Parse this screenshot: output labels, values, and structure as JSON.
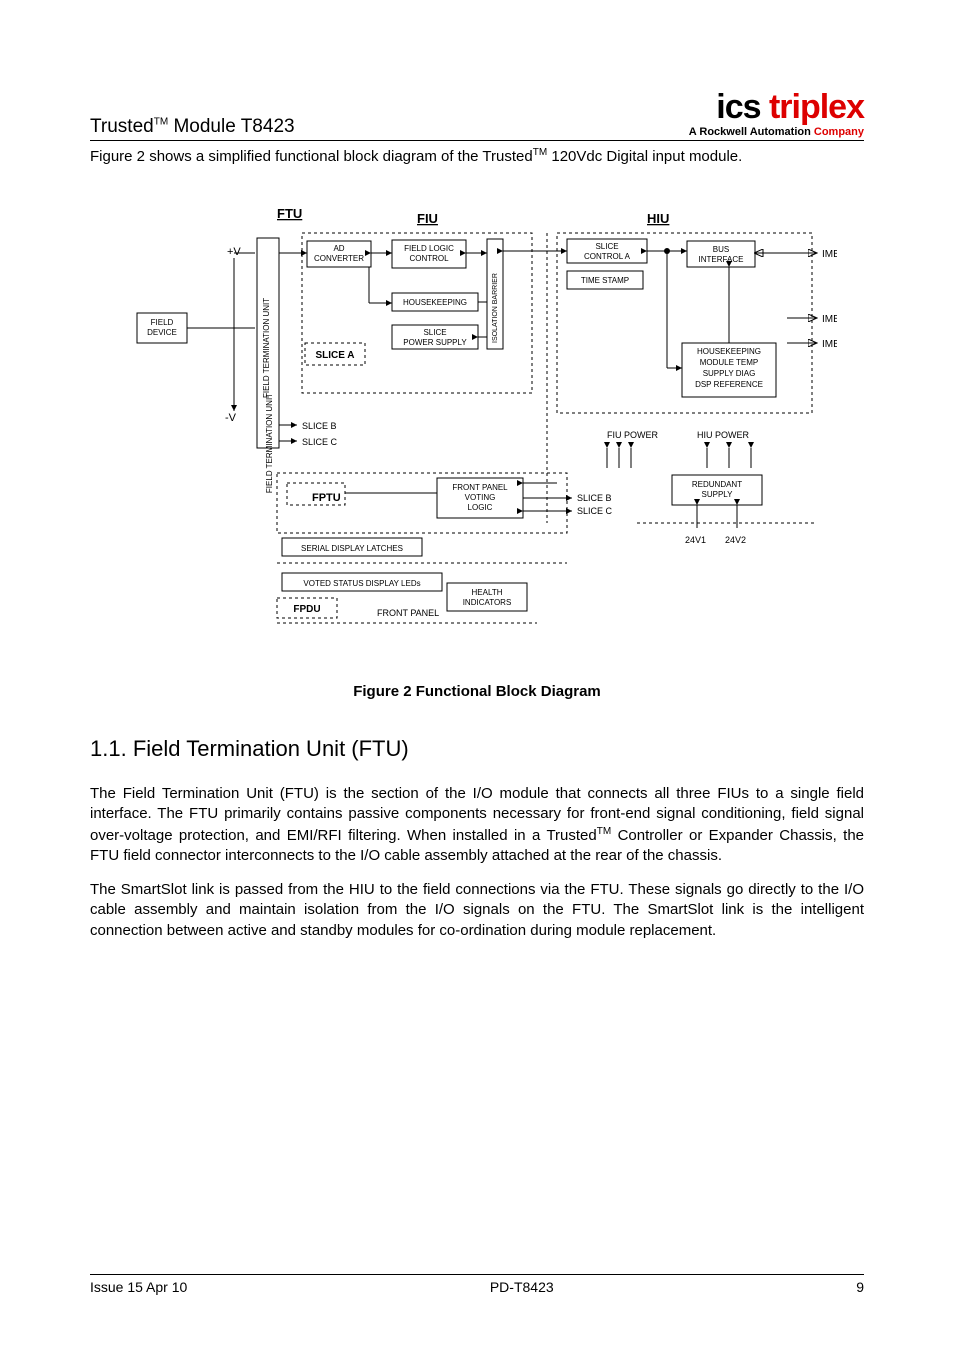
{
  "header": {
    "product_prefix": "Trusted",
    "tm": "TM",
    "product_suffix": " Module T8423",
    "logo_main_black": "ics",
    "logo_main_red": " triplex",
    "logo_sub_black": "A Rockwell Automation ",
    "logo_sub_red": "Company"
  },
  "intro": {
    "pre": "Figure 2 shows a simplified functional block diagram of the Trusted",
    "tm": "TM",
    "post": " 120Vdc Digital input module."
  },
  "diagram": {
    "ftu_label": "FTU",
    "fiu_label": "FIU",
    "hiu_label": "HIU",
    "plus_v": "+V",
    "minus_v": "-V",
    "field_device": "FIELD DEVICE",
    "field_term_unit": "FIELD TERMINATION UNIT",
    "ad_converter": "AD CONVERTER",
    "field_logic_control": "FIELD LOGIC CONTROL",
    "housekeeping": "HOUSEKEEPING",
    "slice_power_supply": "SLICE POWER SUPPLY",
    "slice_a": "SLICE A",
    "slice_b": "SLICE B",
    "slice_c": "SLICE C",
    "isolation_barrier": "ISOLATION BARRIER",
    "slice_control_a": "SLICE CONTROL A",
    "time_stamp": "TIME STAMP",
    "bus_interface": "BUS INTERFACE",
    "imb_a": "IMB A",
    "imb_b": "IMB B",
    "imb_c": "IMB C",
    "hiu_housekeeping": "HOUSEKEEPING MODULE TEMP SUPPLY DIAG DSP REFERENCE",
    "hiu_hk_l1": "HOUSEKEEPING",
    "hiu_hk_l2": "MODULE TEMP",
    "hiu_hk_l3": "SUPPLY DIAG",
    "hiu_hk_l4": "DSP REFERENCE",
    "fiu_power": "FIU POWER",
    "hiu_power": "HIU POWER",
    "fptu": "FPTU",
    "front_panel_voting_logic": "FRONT PANEL VOTING LOGIC",
    "fpvl_l1": "FRONT PANEL",
    "fpvl_l2": "VOTING",
    "fpvl_l3": "LOGIC",
    "redundant_supply": "REDUNDANT SUPPLY",
    "rs_l1": "REDUNDANT",
    "rs_l2": "SUPPLY",
    "serial_display_latches": "SERIAL DISPLAY LATCHES",
    "voted_status_display_leds": "VOTED STATUS DISPLAY LEDs",
    "health_indicators": "HEALTH INDICATORS",
    "hi_l1": "HEALTH",
    "hi_l2": "INDICATORS",
    "fpdu": "FPDU",
    "front_panel": "FRONT PANEL",
    "v24_1": "24V1",
    "v24_2": "24V2"
  },
  "caption": "Figure 2 Functional Block Diagram",
  "section": {
    "number": "1.1.",
    "title": "Field Termination Unit (FTU)"
  },
  "para1": {
    "pre": "The Field Termination Unit (FTU) is the section of the I/O module that connects all three FIUs to a single field interface.  The FTU primarily contains passive components necessary for front-end signal conditioning, field signal over-voltage protection, and EMI/RFI filtering.  When installed in a Trusted",
    "tm": "TM",
    "post": " Controller or Expander Chassis, the FTU field connector interconnects to the I/O cable assembly attached at the rear of the chassis."
  },
  "para2": "The SmartSlot link is passed from the HIU to the field connections via the FTU.  These signals go directly to the I/O cable assembly and maintain isolation from the I/O signals on the FTU.  The SmartSlot link is the intelligent connection between active and standby modules for co-ordination during module replacement.",
  "footer": {
    "left": "Issue 15 Apr 10",
    "center": "PD-T8423",
    "right": "9"
  }
}
